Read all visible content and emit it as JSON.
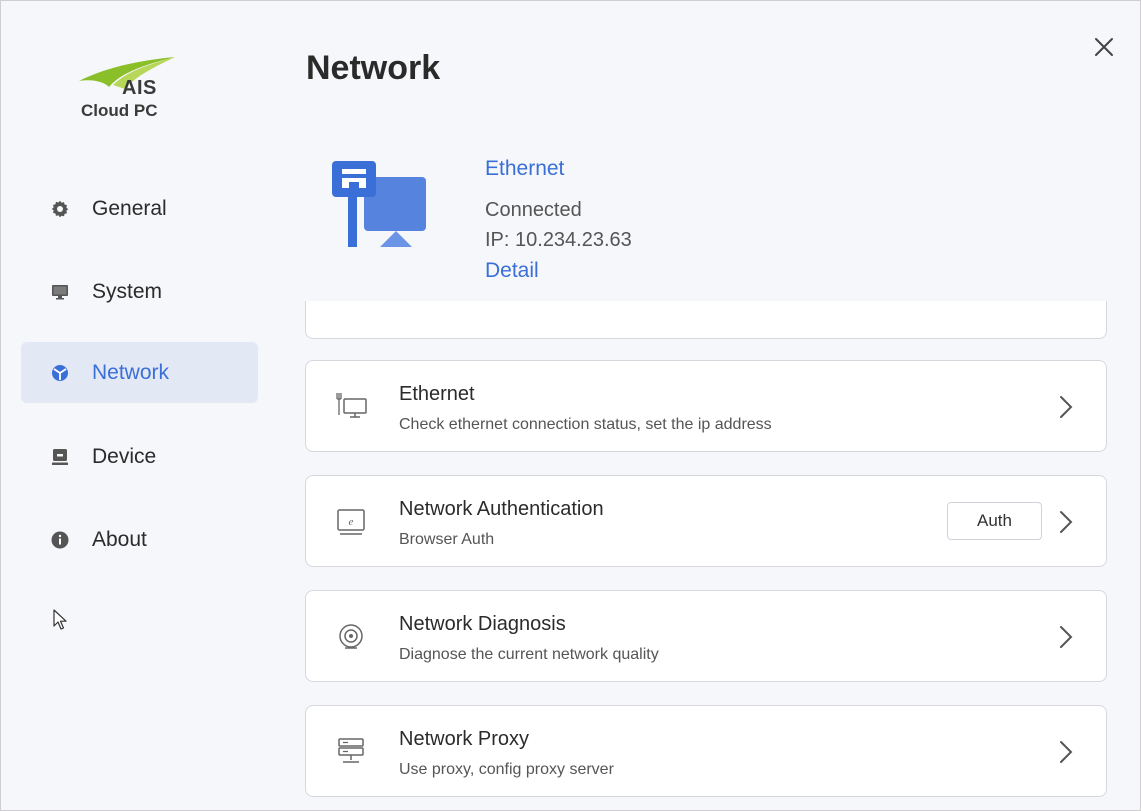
{
  "sidebar": {
    "logo": {
      "brand": "AIS",
      "product": "Cloud PC"
    },
    "items": [
      {
        "label": "General",
        "icon": "gear-icon"
      },
      {
        "label": "System",
        "icon": "monitor-icon"
      },
      {
        "label": "Network",
        "icon": "network-globe-icon",
        "active": true
      },
      {
        "label": "Device",
        "icon": "device-icon"
      },
      {
        "label": "About",
        "icon": "info-icon"
      }
    ]
  },
  "header": {
    "title": "Network",
    "close_icon": "close-icon"
  },
  "connection": {
    "name": "Ethernet",
    "status": "Connected",
    "ip": "IP: 10.234.23.63",
    "detail_link": "Detail"
  },
  "settings": [
    {
      "title": "Ethernet",
      "subtitle": "Check ethernet connection status, set the ip address",
      "icon": "ethernet-monitor-icon"
    },
    {
      "title": "Network Authentication",
      "subtitle": "Browser Auth",
      "icon": "browser-monitor-icon",
      "button": "Auth"
    },
    {
      "title": "Network Diagnosis",
      "subtitle": "Diagnose the current network quality",
      "icon": "diagnosis-icon"
    },
    {
      "title": "Network Proxy",
      "subtitle": "Use proxy, config proxy server",
      "icon": "proxy-server-icon"
    }
  ],
  "colors": {
    "accent": "#3a6fd8",
    "active_bg": "#e3e8f5",
    "background": "#f6f7fa",
    "logo_green": "#8bbf2a"
  }
}
